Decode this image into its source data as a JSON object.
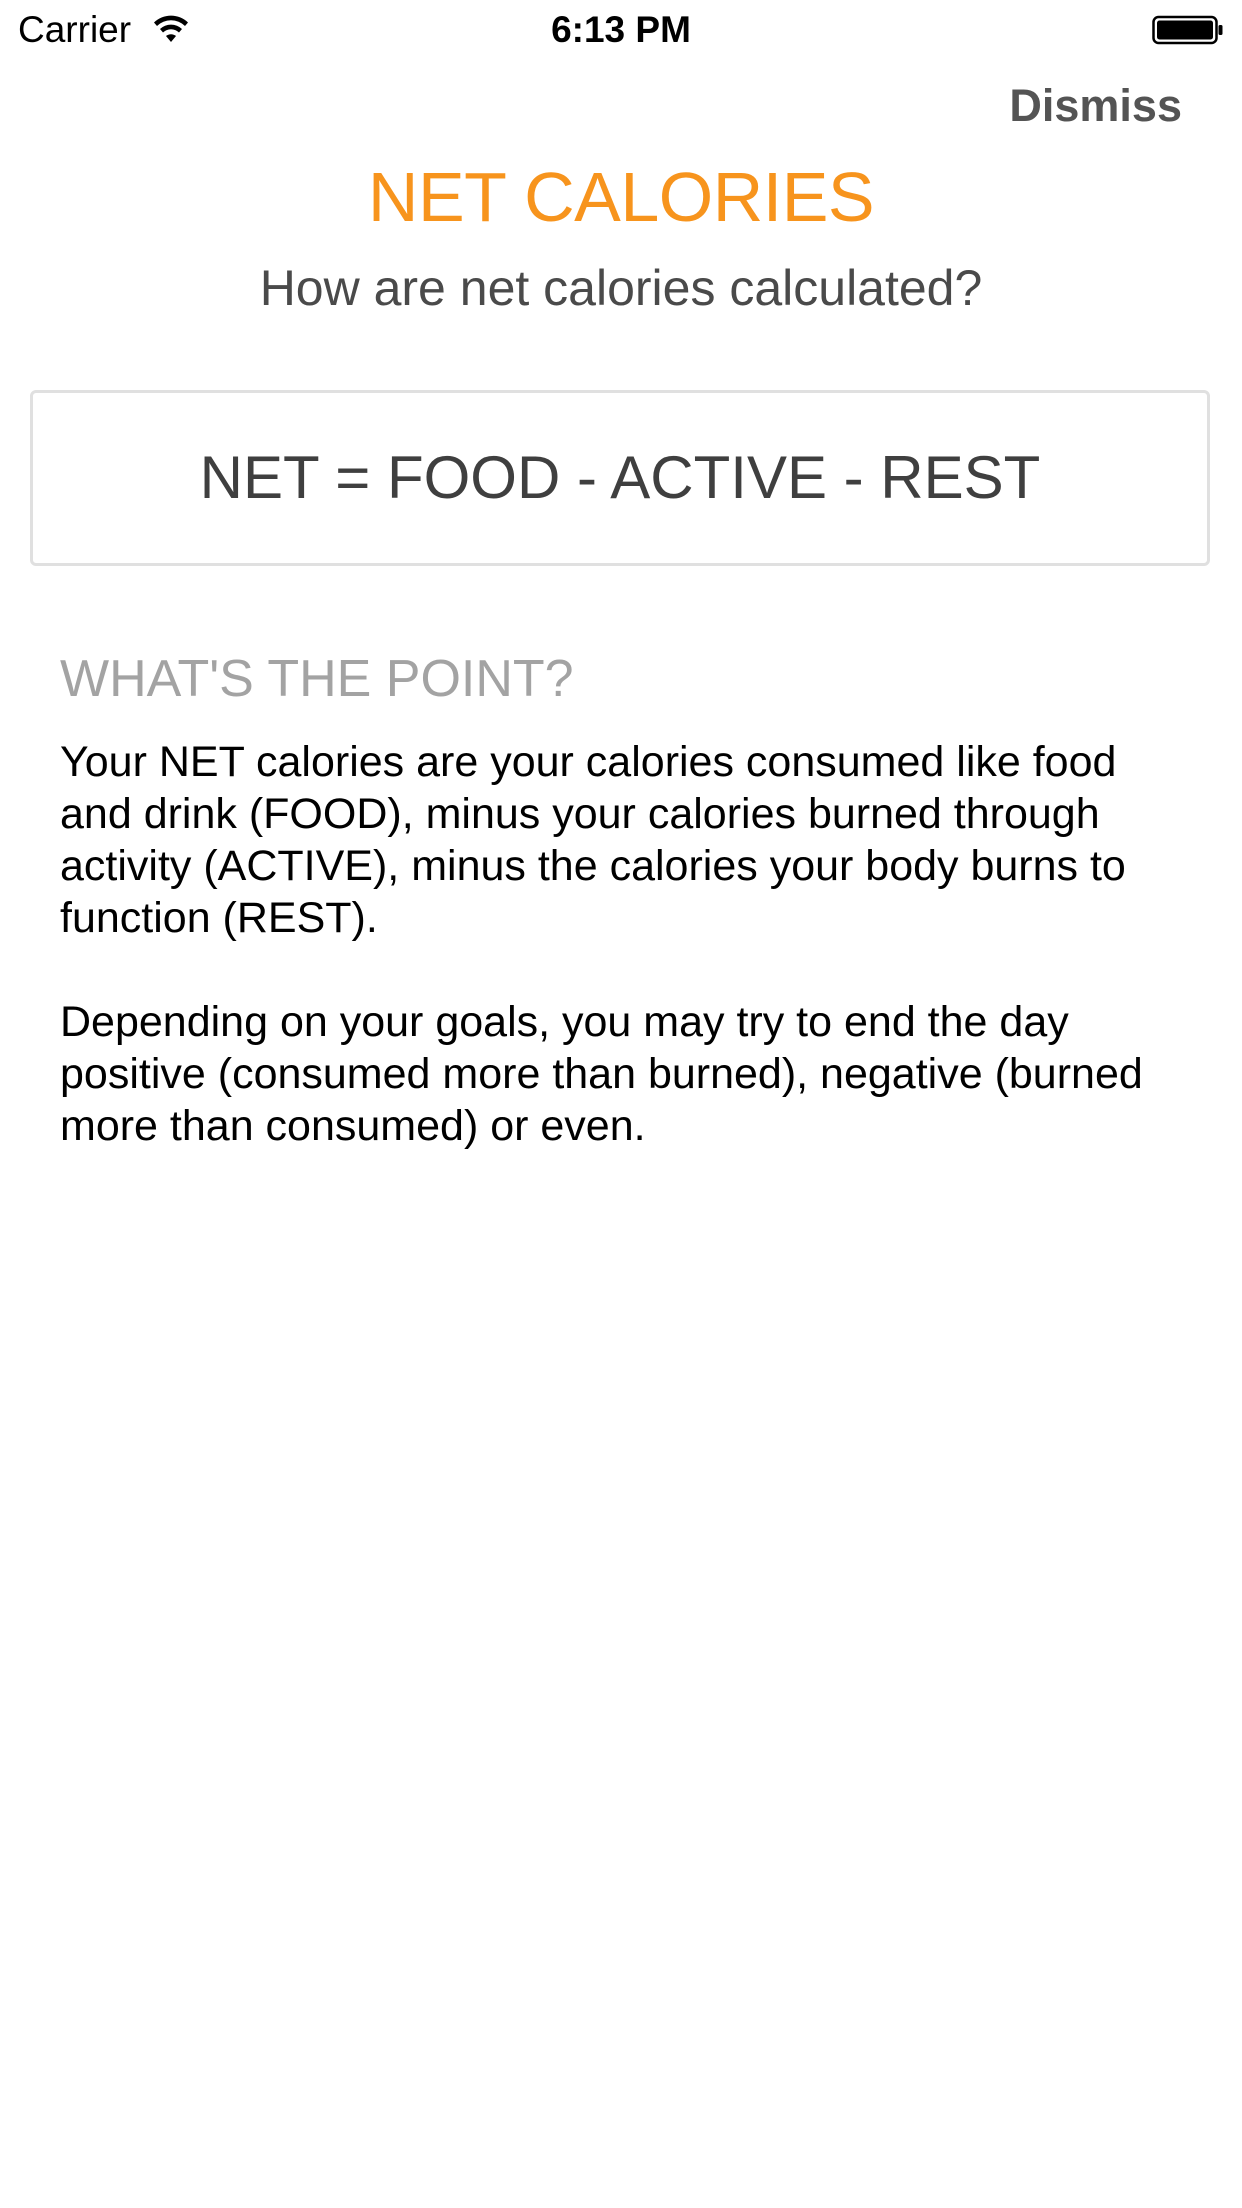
{
  "status_bar": {
    "carrier": "Carrier",
    "time": "6:13 PM"
  },
  "header": {
    "dismiss_label": "Dismiss",
    "title": "NET CALORIES",
    "subtitle": "How are net calories calculated?"
  },
  "formula": {
    "text": "NET = FOOD - ACTIVE - REST"
  },
  "explanation": {
    "heading": "WHAT'S THE POINT?",
    "paragraph_1": "Your NET calories are your calories consumed like food and drink (FOOD), minus your calories burned through activity (ACTIVE), minus the calories your body burns to function (REST).",
    "paragraph_2": "Depending on your goals, you may try to end the day positive (consumed more than burned), negative (burned more than consumed) or even."
  },
  "colors": {
    "accent": "#f7941d",
    "heading_gray": "#a3a3a3",
    "text_dark": "#3f3f3f",
    "card_border": "#e0e0e0"
  },
  "icons": {
    "wifi": "wifi-icon",
    "battery": "battery-icon"
  }
}
